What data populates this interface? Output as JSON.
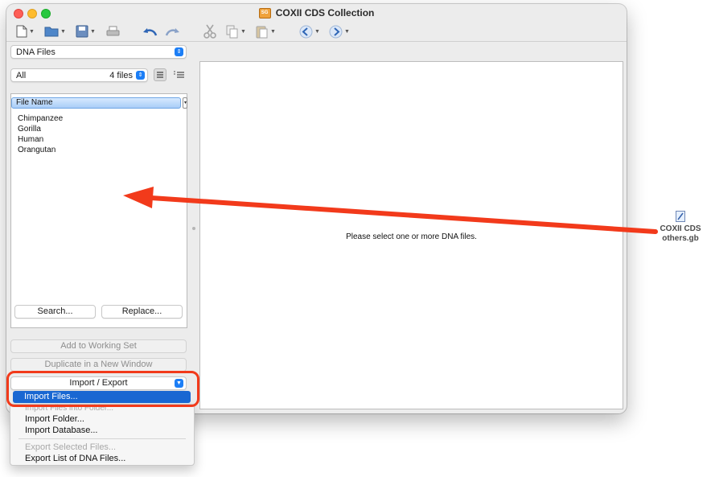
{
  "window": {
    "title": "COXII CDS Collection",
    "title_badge": "SG"
  },
  "toolbar": {
    "items": [
      {
        "icon": "new-document-icon"
      },
      {
        "icon": "open-folder-icon"
      },
      {
        "icon": "save-icon"
      },
      {
        "icon": "print-icon"
      },
      {
        "icon": "undo-icon"
      },
      {
        "icon": "redo-icon"
      },
      {
        "icon": "cut-icon"
      },
      {
        "icon": "copy-icon"
      },
      {
        "icon": "paste-icon"
      },
      {
        "icon": "back-icon"
      },
      {
        "icon": "forward-icon"
      }
    ]
  },
  "sidebar": {
    "file_type": "DNA Files",
    "filter": "All",
    "file_count": "4 files",
    "column_header": "File Name",
    "files": [
      "Chimpanzee",
      "Gorilla",
      "Human",
      "Orangutan"
    ],
    "search_label": "Search...",
    "replace_label": "Replace...",
    "add_working_set": "Add to Working Set",
    "duplicate_window": "Duplicate in a New Window",
    "import_export": "Import / Export"
  },
  "main": {
    "message": "Please select one or more DNA files."
  },
  "menu": {
    "highlighted": "Import Files...",
    "items": [
      "Import Files into Folder...",
      "Import Folder...",
      "Import Database...",
      "Export Selected Files...",
      "Export List of DNA Files..."
    ]
  },
  "desktop": {
    "file_line1": "COXII CDS",
    "file_line2": "others.gb"
  },
  "colors": {
    "accent": "#1967d2",
    "annotation_red": "#f23a1b"
  }
}
